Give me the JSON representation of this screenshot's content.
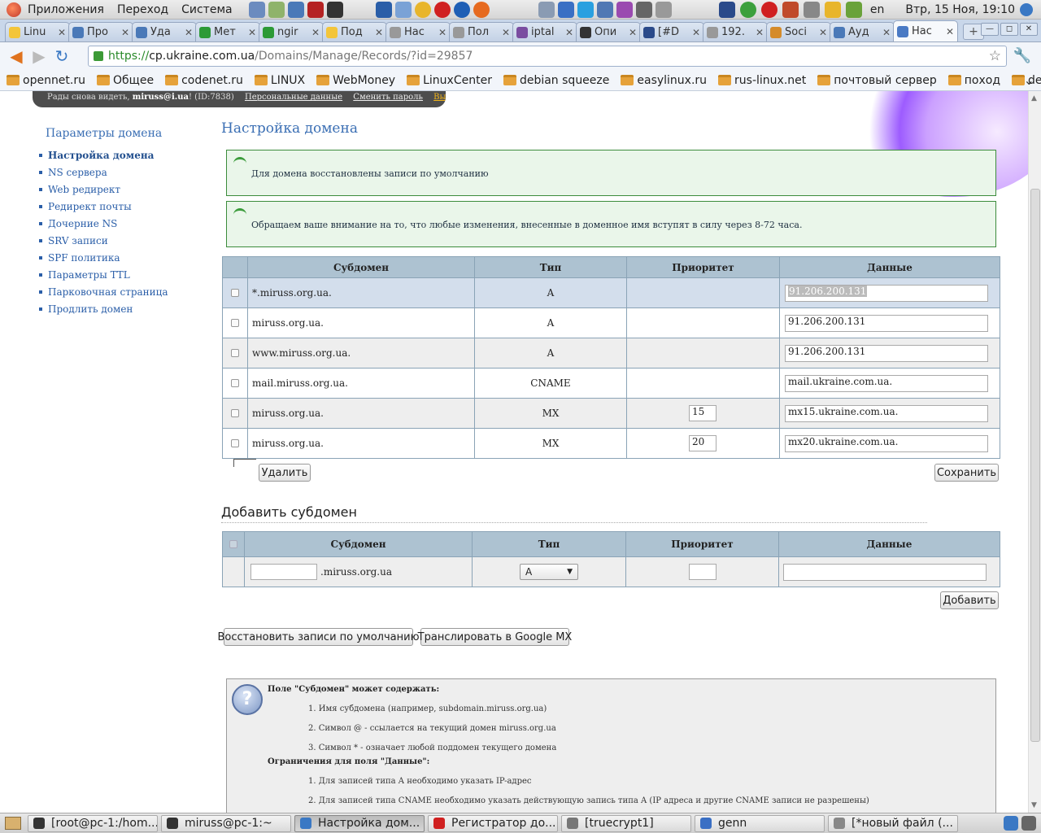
{
  "os_panel": {
    "menus": [
      "Приложения",
      "Переход",
      "Система"
    ],
    "lang": "en",
    "clock": "Втр, 15 Ноя, 19:10"
  },
  "browser": {
    "tabs": [
      {
        "title": "Linu",
        "color": "#f3c53a"
      },
      {
        "title": "Про",
        "color": "#4a79b8"
      },
      {
        "title": "Уда",
        "color": "#4a79b8"
      },
      {
        "title": "Мет",
        "color": "#2c9a36"
      },
      {
        "title": "ngir",
        "color": "#2c9a36"
      },
      {
        "title": "Под",
        "color": "#f3c53a"
      },
      {
        "title": "Нас",
        "color": "#999999"
      },
      {
        "title": "Пол",
        "color": "#999999"
      },
      {
        "title": "iptal",
        "color": "#7a4da0"
      },
      {
        "title": "Опи",
        "color": "#333333"
      },
      {
        "title": "[#D",
        "color": "#2a4a8a"
      },
      {
        "title": "192.",
        "color": "#999999"
      },
      {
        "title": "Soci",
        "color": "#d58b2a"
      },
      {
        "title": "Ауд",
        "color": "#4a79b8"
      },
      {
        "title": "Нас",
        "color": "#4a7ac4"
      }
    ],
    "url_proto": "https://",
    "url_host": "cp.ukraine.com.ua",
    "url_path": "/Domains/Manage/Records/?id=29857",
    "bookmarks": [
      "opennet.ru",
      "Общее",
      "codenet.ru",
      "LINUX",
      "WebMoney",
      "LinuxCenter",
      "debian squeeze",
      "easylinux.ru",
      "rus-linux.net",
      "почтовый сервер",
      "поход",
      "dedic"
    ]
  },
  "userbar": {
    "greeting": "Рады снова видеть,",
    "user": "miruss@i.ua",
    "id": "! (ID:7838)",
    "links": [
      "Персональные данные",
      "Сменить пароль",
      "Выход"
    ]
  },
  "sidebar": {
    "title": "Параметры домена",
    "items": [
      "Настройка домена",
      "NS сервера",
      "Web редирект",
      "Редирект почты",
      "Дочерние NS",
      "SRV записи",
      "SPF политика",
      "Параметры TTL",
      "Парковочная страница",
      "Продлить домен"
    ]
  },
  "main": {
    "title": "Настройка домена",
    "notices": [
      "Для домена восстановлены записи по умолчанию",
      "Обращаем ваше внимание на то, что любые изменения, внесенные в доменное имя вступят в силу через 8-72 часа."
    ],
    "records_headers": [
      "Субдомен",
      "Тип",
      "Приоритет",
      "Данные"
    ],
    "records": [
      {
        "sub": "*.miruss.org.ua.",
        "type": "A",
        "priority": "",
        "data": "91.206.200.131"
      },
      {
        "sub": "miruss.org.ua.",
        "type": "A",
        "priority": "",
        "data": "91.206.200.131"
      },
      {
        "sub": "www.miruss.org.ua.",
        "type": "A",
        "priority": "",
        "data": "91.206.200.131"
      },
      {
        "sub": "mail.miruss.org.ua.",
        "type": "CNAME",
        "priority": "",
        "data": "mail.ukraine.com.ua."
      },
      {
        "sub": "miruss.org.ua.",
        "type": "MX",
        "priority": "15",
        "data": "mx15.ukraine.com.ua."
      },
      {
        "sub": "miruss.org.ua.",
        "type": "MX",
        "priority": "20",
        "data": "mx20.ukraine.com.ua."
      }
    ],
    "delete_label": "Удалить",
    "save_label": "Сохранить",
    "add_title": "Добавить субдомен",
    "add_headers": [
      "Субдомен",
      "Тип",
      "Приоритет",
      "Данные"
    ],
    "add_suffix": ".miruss.org.ua",
    "add_type": "A",
    "add_label": "Добавить",
    "restore_label": "Восстановить записи по умолчанию",
    "google_label": "Транслировать в Google MX"
  },
  "help": {
    "h1": "Поле \"Субдомен\" может содержать:",
    "items1": [
      "1. Имя субдомена (например, subdomain.miruss.org.ua)",
      "2. Символ @ - ссылается на текущий домен miruss.org.ua",
      "3. Символ * - означает любой поддомен текущего домена"
    ],
    "h2": "Ограничения для поля \"Данные\":",
    "items2": [
      "1. Для записей типа A необходимо указать IP-адрес",
      "2. Для записей типа CNAME необходимо указать действующую запись типа A (IP адреса и другие CNAME записи не разрешены)"
    ]
  },
  "taskbar": {
    "tasks": [
      "[root@pc-1:/hom...",
      "miruss@pc-1:~",
      "Настройка дом...",
      "Регистратор до...",
      "[truecrypt1]",
      "genn",
      "[*новый файл (..."
    ]
  }
}
